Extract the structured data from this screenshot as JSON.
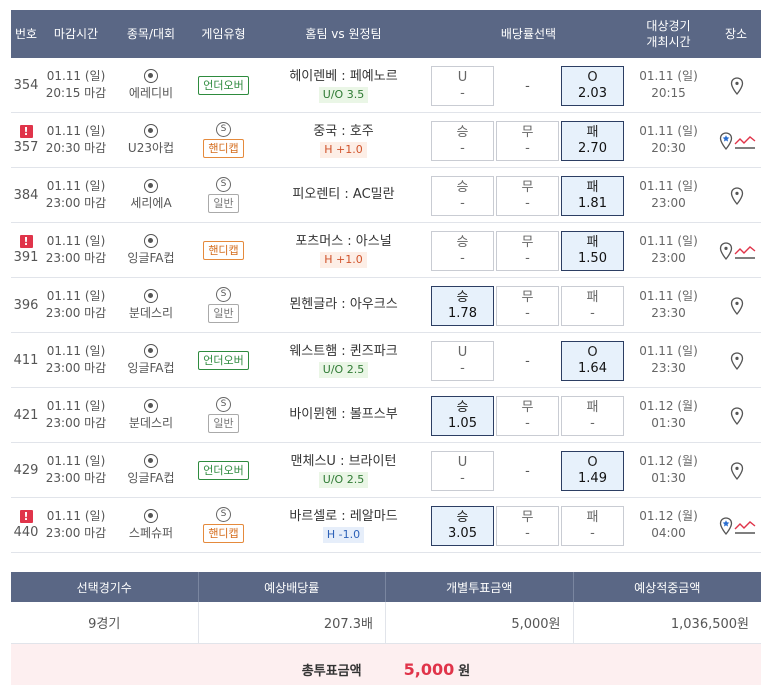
{
  "header": {
    "no": "번호",
    "deadline": "마감시간",
    "sport": "종목/대회",
    "type": "게임유형",
    "teams": "홈팀 vs 원정팀",
    "odds": "배당률선택",
    "date_line1": "대상경기",
    "date_line2": "개최시간",
    "place": "장소"
  },
  "rows": [
    {
      "no": "354",
      "alert": false,
      "date": "01.11 (일)",
      "time": "20:15 마감",
      "sport": "에레디비",
      "s": false,
      "type": "언더오버",
      "type_kind": "uo",
      "teams": "헤이렌베 : 페예노르",
      "hinfo": "U/O 3.5",
      "hkind": "uo",
      "o1_label": "U",
      "o1_val": "-",
      "o1_sel": false,
      "o2_label": "-",
      "o2_val": "",
      "o2_box": false,
      "o3_label": "O",
      "o3_val": "2.03",
      "o3_sel": true,
      "gdate": "01.11 (일)",
      "gtime": "20:15",
      "place_icon": "location-pin-icon",
      "star": false
    },
    {
      "no": "357",
      "alert": true,
      "date": "01.11 (일)",
      "time": "20:30 마감",
      "sport": "U23아컵",
      "s": true,
      "type": "핸디캡",
      "type_kind": "hc",
      "teams": "중국 : 호주",
      "hinfo": "H +1.0",
      "hkind": "hp",
      "o1_label": "승",
      "o1_val": "-",
      "o1_sel": false,
      "o2_label": "무",
      "o2_val": "-",
      "o2_box": true,
      "o3_label": "패",
      "o3_val": "2.70",
      "o3_sel": true,
      "gdate": "01.11 (일)",
      "gtime": "20:30",
      "place_icon": "location-star-icon",
      "star": true
    },
    {
      "no": "384",
      "alert": false,
      "date": "01.11 (일)",
      "time": "23:00 마감",
      "sport": "세리에A",
      "s": true,
      "type": "일반",
      "type_kind": "gen",
      "teams": "피오렌티 : AC밀란",
      "hinfo": "",
      "hkind": "",
      "o1_label": "승",
      "o1_val": "-",
      "o1_sel": false,
      "o2_label": "무",
      "o2_val": "-",
      "o2_box": true,
      "o3_label": "패",
      "o3_val": "1.81",
      "o3_sel": true,
      "gdate": "01.11 (일)",
      "gtime": "23:00",
      "place_icon": "location-pin-icon",
      "star": false
    },
    {
      "no": "391",
      "alert": true,
      "date": "01.11 (일)",
      "time": "23:00 마감",
      "sport": "잉글FA컵",
      "s": false,
      "type": "핸디캡",
      "type_kind": "hc",
      "teams": "포츠머스 : 아스널",
      "hinfo": "H +1.0",
      "hkind": "hp",
      "o1_label": "승",
      "o1_val": "-",
      "o1_sel": false,
      "o2_label": "무",
      "o2_val": "-",
      "o2_box": true,
      "o3_label": "패",
      "o3_val": "1.50",
      "o3_sel": true,
      "gdate": "01.11 (일)",
      "gtime": "23:00",
      "place_icon": "location-pin-icon",
      "star": false,
      "trend": true
    },
    {
      "no": "396",
      "alert": false,
      "date": "01.11 (일)",
      "time": "23:00 마감",
      "sport": "분데스리",
      "s": true,
      "type": "일반",
      "type_kind": "gen",
      "teams": "묀헨글라 : 아우크스",
      "hinfo": "",
      "hkind": "",
      "o1_label": "승",
      "o1_val": "1.78",
      "o1_sel": true,
      "o2_label": "무",
      "o2_val": "-",
      "o2_box": true,
      "o3_label": "패",
      "o3_val": "-",
      "o3_sel": false,
      "gdate": "01.11 (일)",
      "gtime": "23:30",
      "place_icon": "location-pin-icon",
      "star": false
    },
    {
      "no": "411",
      "alert": false,
      "date": "01.11 (일)",
      "time": "23:00 마감",
      "sport": "잉글FA컵",
      "s": false,
      "type": "언더오버",
      "type_kind": "uo",
      "teams": "웨스트햄 : 퀸즈파크",
      "hinfo": "U/O 2.5",
      "hkind": "uo",
      "o1_label": "U",
      "o1_val": "-",
      "o1_sel": false,
      "o2_label": "-",
      "o2_val": "",
      "o2_box": false,
      "o3_label": "O",
      "o3_val": "1.64",
      "o3_sel": true,
      "gdate": "01.11 (일)",
      "gtime": "23:30",
      "place_icon": "location-pin-icon",
      "star": false
    },
    {
      "no": "421",
      "alert": false,
      "date": "01.11 (일)",
      "time": "23:00 마감",
      "sport": "분데스리",
      "s": true,
      "type": "일반",
      "type_kind": "gen",
      "teams": "바이뮌헨 : 볼프스부",
      "hinfo": "",
      "hkind": "",
      "o1_label": "승",
      "o1_val": "1.05",
      "o1_sel": true,
      "o2_label": "무",
      "o2_val": "-",
      "o2_box": true,
      "o3_label": "패",
      "o3_val": "-",
      "o3_sel": false,
      "gdate": "01.12 (월)",
      "gtime": "01:30",
      "place_icon": "location-pin-icon",
      "star": false
    },
    {
      "no": "429",
      "alert": false,
      "date": "01.11 (일)",
      "time": "23:00 마감",
      "sport": "잉글FA컵",
      "s": false,
      "type": "언더오버",
      "type_kind": "uo",
      "teams": "맨체스U : 브라이턴",
      "hinfo": "U/O 2.5",
      "hkind": "uo",
      "o1_label": "U",
      "o1_val": "-",
      "o1_sel": false,
      "o2_label": "-",
      "o2_val": "",
      "o2_box": false,
      "o3_label": "O",
      "o3_val": "1.49",
      "o3_sel": true,
      "gdate": "01.12 (월)",
      "gtime": "01:30",
      "place_icon": "location-pin-icon",
      "star": false
    },
    {
      "no": "440",
      "alert": true,
      "date": "01.11 (일)",
      "time": "23:00 마감",
      "sport": "스페슈퍼",
      "s": true,
      "type": "핸디캡",
      "type_kind": "hc",
      "teams": "바르셀로 : 레알마드",
      "hinfo": "H -1.0",
      "hkind": "hm",
      "o1_label": "승",
      "o1_val": "3.05",
      "o1_sel": true,
      "o2_label": "무",
      "o2_val": "-",
      "o2_box": true,
      "o3_label": "패",
      "o3_val": "-",
      "o3_sel": false,
      "gdate": "01.12 (월)",
      "gtime": "04:00",
      "place_icon": "location-star-icon",
      "star": true
    }
  ],
  "summary": {
    "h_count": "선택경기수",
    "h_rate": "예상배당률",
    "h_each": "개별투표금액",
    "h_expected": "예상적중금액",
    "count": "9경기",
    "rate": "207.3배",
    "each": "5,000원",
    "expected": "1,036,500원"
  },
  "total": {
    "label": "총투표금액",
    "value": "5,000",
    "unit": "원"
  },
  "colors": {
    "header_bg": "#5a6785",
    "selected_bg": "#e7f1fb",
    "accent_red": "#e0344a"
  }
}
